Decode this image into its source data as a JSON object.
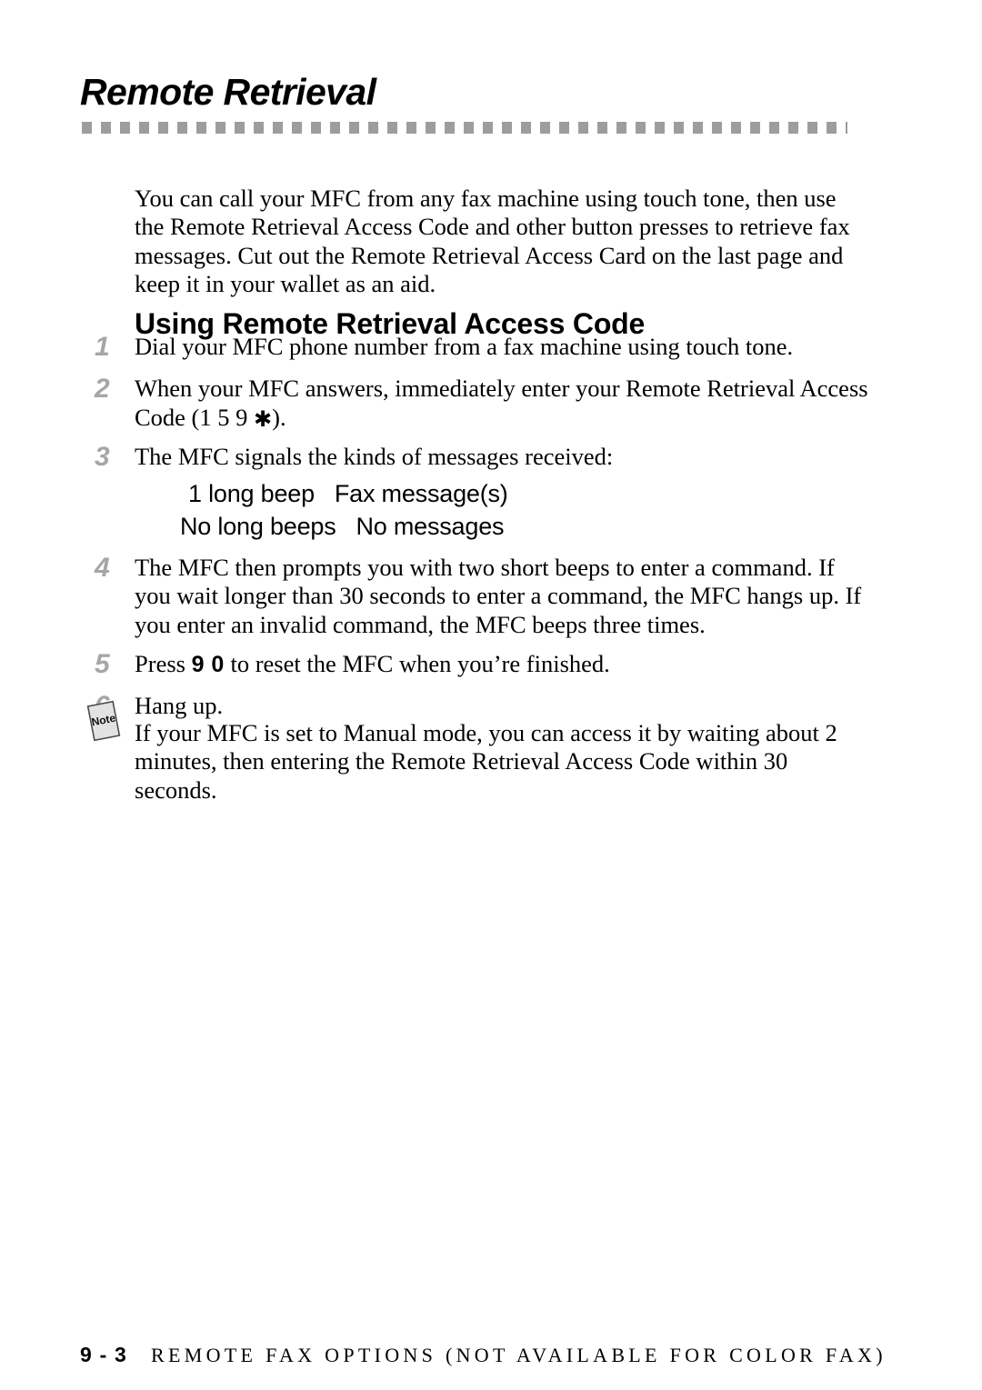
{
  "page": {
    "chapter_title": "Remote Retrieval"
  },
  "intro": {
    "paragraph": "You can call your MFC from any fax machine using touch tone, then use the Remote Retrieval Access Code and other button presses to retrieve fax messages. Cut out the Remote Retrieval Access Card on the last page and keep it in your wallet as an aid."
  },
  "section": {
    "heading": "Using Remote Retrieval Access Code"
  },
  "steps": [
    {
      "number": "1",
      "text": "Dial your MFC phone number from a fax machine using touch tone."
    },
    {
      "number": "2",
      "text_before": "When your MFC answers, immediately enter your Remote Retrieval Access Code (1 5 9 ",
      "star": "✱",
      "text_after": ")."
    },
    {
      "number": "3",
      "text": "The MFC signals the kinds of messages received:",
      "beeps": [
        {
          "signal": "1 long beep",
          "meaning": "Fax message(s)"
        },
        {
          "signal": "No long beeps",
          "meaning": "No messages"
        }
      ]
    },
    {
      "number": "4",
      "text": "The MFC then prompts you with two short beeps to enter a command.  If you wait longer than 30 seconds to enter a command, the MFC hangs up.  If you enter an invalid command, the MFC beeps three times."
    },
    {
      "number": "5",
      "text_before": "Press ",
      "key": "9 0",
      "text_after": " to reset the MFC when you’re finished."
    },
    {
      "number": "6",
      "text": "Hang up."
    }
  ],
  "note": {
    "icon_label": "Note",
    "text": "If your MFC is set to Manual mode, you can access it by waiting about 2 minutes, then entering the Remote Retrieval Access Code within 30 seconds."
  },
  "footer": {
    "page_number": "9 - 3",
    "label": "REMOTE FAX OPTIONS (NOT AVAILABLE FOR COLOR FAX)"
  },
  "colors": {
    "text": "#000000",
    "step_number": "#a6a6a6",
    "rule": "#9d9d9d",
    "note_fill": "#e2e2e2"
  }
}
